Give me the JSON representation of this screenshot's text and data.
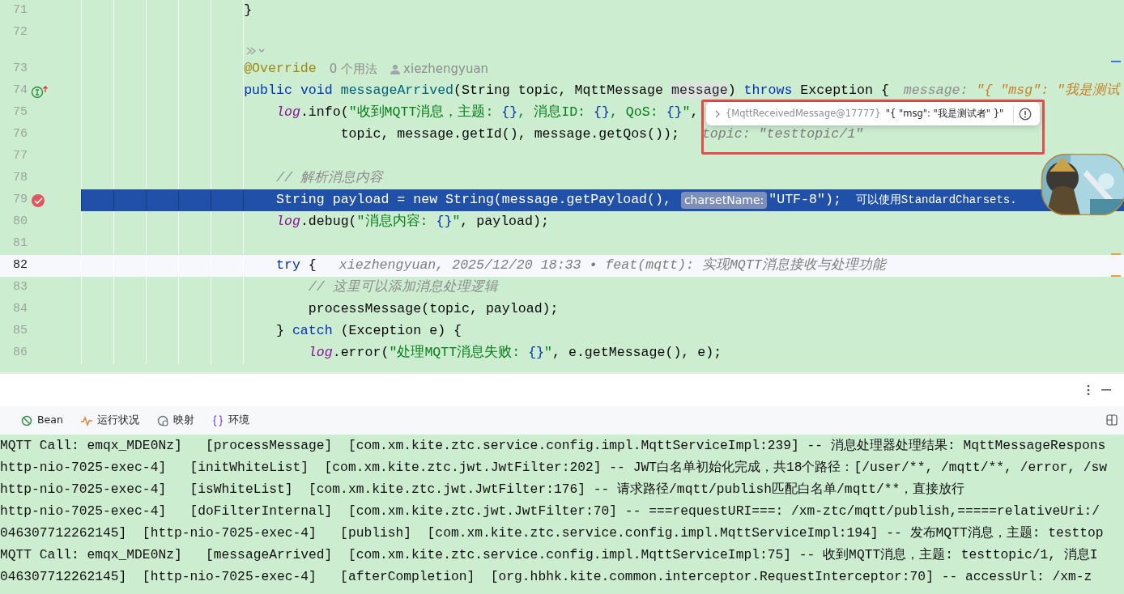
{
  "editor": {
    "lines": [
      {
        "number": "71",
        "kind": "code",
        "parts": [
          {
            "kind": "code",
            "tokens": [
              {
                "kind": "plain",
                "text": "                    }"
              }
            ]
          }
        ]
      },
      {
        "number": "72",
        "kind": "code"
      },
      {
        "kind": "fold"
      },
      {
        "number": "73",
        "kind": "code",
        "parts": [
          {
            "kind": "code",
            "tokens": [
              {
                "kind": "annotation",
                "text": "                    @Override"
              }
            ]
          },
          {
            "kind": "usages",
            "text": "0 个用法"
          },
          {
            "kind": "author",
            "text": "xiezhengyuan"
          }
        ]
      },
      {
        "number": "74",
        "kind": "code",
        "implements": true,
        "parts": [
          {
            "kind": "code",
            "tokens": [
              {
                "kind": "keyword",
                "text": "                    public "
              },
              {
                "kind": "keyword",
                "text": "void "
              },
              {
                "kind": "method",
                "text": "messageArrived"
              },
              {
                "kind": "plain",
                "text": "(String topic, MqttMessage "
              },
              {
                "kind": "usage",
                "text": "message"
              },
              {
                "kind": "plain",
                "text": ") "
              },
              {
                "kind": "keyword",
                "text": "throws"
              },
              {
                "kind": "plain",
                "text": " Exception {"
              }
            ]
          },
          {
            "kind": "inline-value",
            "label": "message:",
            "text": "\"{ \"msg\": \"我是测试"
          }
        ]
      },
      {
        "number": "75",
        "kind": "code",
        "parts": [
          {
            "kind": "code",
            "tokens": [
              {
                "kind": "log",
                "text": "                        log"
              },
              {
                "kind": "plain",
                "text": ".info("
              },
              {
                "kind": "string",
                "text": "\"收到MQTT消息，主题: "
              },
              {
                "kind": "placeholder",
                "text": "{}"
              },
              {
                "kind": "string",
                "text": ", 消息ID: "
              },
              {
                "kind": "placeholder",
                "text": "{}"
              },
              {
                "kind": "string",
                "text": ", QoS: "
              },
              {
                "kind": "placeholder",
                "text": "{}"
              },
              {
                "kind": "string",
                "text": "\""
              },
              {
                "kind": "plain",
                "text": ","
              }
            ]
          }
        ]
      },
      {
        "number": "76",
        "kind": "code",
        "parts": [
          {
            "kind": "code",
            "tokens": [
              {
                "kind": "plain",
                "text": "                                topic, message.getId(), message.getQos());"
              }
            ]
          },
          {
            "kind": "hint",
            "text": "topic: \"testtopic/1\""
          }
        ]
      },
      {
        "number": "77",
        "kind": "code"
      },
      {
        "number": "78",
        "kind": "code",
        "parts": [
          {
            "kind": "code",
            "tokens": [
              {
                "kind": "comment",
                "text": "                        // 解析消息内容"
              }
            ]
          }
        ]
      },
      {
        "number": "79",
        "kind": "execution",
        "breakpoint": true,
        "parts": [
          {
            "kind": "code",
            "tokens": [
              {
                "kind": "plain",
                "text": "                        String payload = new String(message.getPayload(), "
              }
            ]
          },
          {
            "kind": "param-hint",
            "text": "charsetName:"
          },
          {
            "kind": "code",
            "tokens": [
              {
                "kind": "plain",
                "text": "\"UTF-8\");"
              }
            ]
          },
          {
            "kind": "warning",
            "text": "可以使用StandardCharsets."
          }
        ]
      },
      {
        "number": "80",
        "kind": "code",
        "parts": [
          {
            "kind": "code",
            "tokens": [
              {
                "kind": "log",
                "text": "                        log"
              },
              {
                "kind": "plain",
                "text": ".debug("
              },
              {
                "kind": "string",
                "text": "\"消息内容: "
              },
              {
                "kind": "placeholder",
                "text": "{}"
              },
              {
                "kind": "string",
                "text": "\""
              },
              {
                "kind": "plain",
                "text": ", payload);"
              }
            ]
          }
        ]
      },
      {
        "number": "81",
        "kind": "code"
      },
      {
        "number": "82",
        "kind": "caret",
        "parts": [
          {
            "kind": "code",
            "tokens": [
              {
                "kind": "keyword",
                "text": "                        try"
              },
              {
                "kind": "plain",
                "text": " {"
              }
            ]
          },
          {
            "kind": "hint",
            "text": "xiezhengyuan, 2025/12/20 18:33 • feat(mqtt): 实现MQTT消息接收与处理功能"
          }
        ]
      },
      {
        "number": "83",
        "kind": "code",
        "parts": [
          {
            "kind": "code",
            "tokens": [
              {
                "kind": "comment",
                "text": "                            // 这里可以添加消息处理逻辑"
              }
            ]
          }
        ]
      },
      {
        "number": "84",
        "kind": "code",
        "parts": [
          {
            "kind": "code",
            "tokens": [
              {
                "kind": "plain",
                "text": "                            processMessage(topic, payload);"
              }
            ]
          }
        ]
      },
      {
        "number": "85",
        "kind": "code",
        "parts": [
          {
            "kind": "code",
            "tokens": [
              {
                "kind": "plain",
                "text": "                        } "
              },
              {
                "kind": "keyword",
                "text": "catch"
              },
              {
                "kind": "plain",
                "text": " (Exception e) {"
              }
            ]
          }
        ]
      },
      {
        "number": "86",
        "kind": "code",
        "parts": [
          {
            "kind": "code",
            "tokens": [
              {
                "kind": "log",
                "text": "                            log"
              },
              {
                "kind": "plain",
                "text": ".error("
              },
              {
                "kind": "string",
                "text": "\"处理MQTT消息失败: "
              },
              {
                "kind": "placeholder",
                "text": "{}"
              },
              {
                "kind": "string",
                "text": "\""
              },
              {
                "kind": "plain",
                "text": ", e.getMessage(), e);"
              }
            ]
          }
        ]
      }
    ]
  },
  "value_popup": {
    "type": "{MqttReceivedMessage@17777}",
    "value": "\"{ \"msg\": \"我是测试者\" }\""
  },
  "bottom_panel": {
    "tabs": [
      {
        "label": "Bean"
      },
      {
        "label": "运行状况"
      },
      {
        "label": "映射"
      },
      {
        "label": "环境"
      }
    ],
    "log_lines": [
      "MQTT Call: emqx_MDE0Nz]   [processMessage]  [com.xm.kite.ztc.service.config.impl.MqttServiceImpl:239] -- 消息处理器处理结果: MqttMessageRespons",
      "http-nio-7025-exec-4]   [initWhiteList]  [com.xm.kite.ztc.jwt.JwtFilter:202] -- JWT白名单初始化完成，共18个路径：[/user/**, /mqtt/**, /error, /sw",
      "http-nio-7025-exec-4]   [isWhiteList]  [com.xm.kite.ztc.jwt.JwtFilter:176] -- 请求路径/mqtt/publish匹配白名单/mqtt/**，直接放行",
      "http-nio-7025-exec-4]   [doFilterInternal]  [com.xm.kite.ztc.jwt.JwtFilter:70] -- ===requestURI===: /xm-ztc/mqtt/publish,=====relativeUri:/",
      "046307712262145]  [http-nio-7025-exec-4]   [publish]  [com.xm.kite.ztc.service.config.impl.MqttServiceImpl:194] -- 发布MQTT消息，主题: testtop",
      "MQTT Call: emqx_MDE0Nz]   [messageArrived]  [com.xm.kite.ztc.service.config.impl.MqttServiceImpl:75] -- 收到MQTT消息，主题: testtopic/1, 消息I",
      "046307712262145]  [http-nio-7025-exec-4]   [afterCompletion]  [org.hbhk.kite.common.interceptor.RequestInterceptor:70] -- accessUrl: /xm-z"
    ]
  }
}
